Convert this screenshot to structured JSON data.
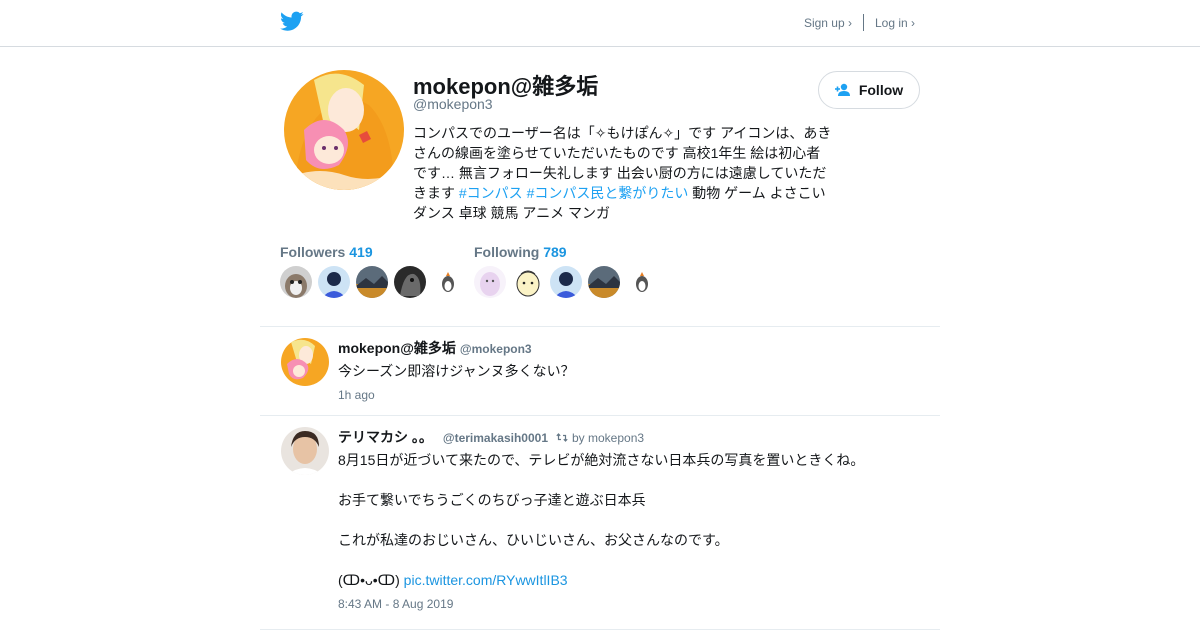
{
  "header": {
    "logo_icon": "twitter-bird-icon",
    "signup_label": "Sign up ›",
    "login_label": "Log in ›"
  },
  "profile": {
    "name": "mokepon@雑多垢",
    "handle": "@mokepon3",
    "follow_label": "Follow",
    "follow_icon": "add-user-icon",
    "bio": {
      "text_1": "コンパスでのユーザー名は「✧もけぽん✧」です アイコンは、あきさんの線画を塗らせていただいたものです 高校1年生 絵は初心者です… 無言フォロー失礼します 出会い厨の方には遠慮していただきます ",
      "tag_1": "#コンパス",
      "tag_2": "#コンパス民と繋がりたい",
      "text_2": " 動物 ゲーム よさこい ダンス 卓球 競馬 アニメ マンガ"
    },
    "followers_label": "Followers",
    "followers_count": "419",
    "following_label": "Following",
    "following_count": "789"
  },
  "tweets": [
    {
      "name": "mokepon@雑多垢",
      "handle": "@mokepon3",
      "text": "今シーズン即溶けジャンヌ多くない？",
      "time": "1h ago"
    },
    {
      "name": "テリマカシ 。。",
      "handle": "@terimakasih0001",
      "retweet_label": "by mokepon3",
      "retweet_icon": "retweet-icon",
      "lines": [
        "8月15日が近づいて来たので、テレビが絶対流さない日本兵の写真を置いときくね。",
        "お手て繋いでちうごくのちびっ子達と遊ぶ日本兵",
        "これが私達のおじいさん、ひいじいさん、お父さんなのです。"
      ],
      "last_prefix": "(ↀ•ᴗ•ↀ) ",
      "link": "pic.twitter.com/RYwwItlIB3",
      "time": "8:43 AM - 8 Aug 2019"
    }
  ],
  "colors": {
    "accent": "#1da1f2",
    "link": "#1b95e0",
    "muted": "#657786",
    "border": "#e6ecf0"
  }
}
